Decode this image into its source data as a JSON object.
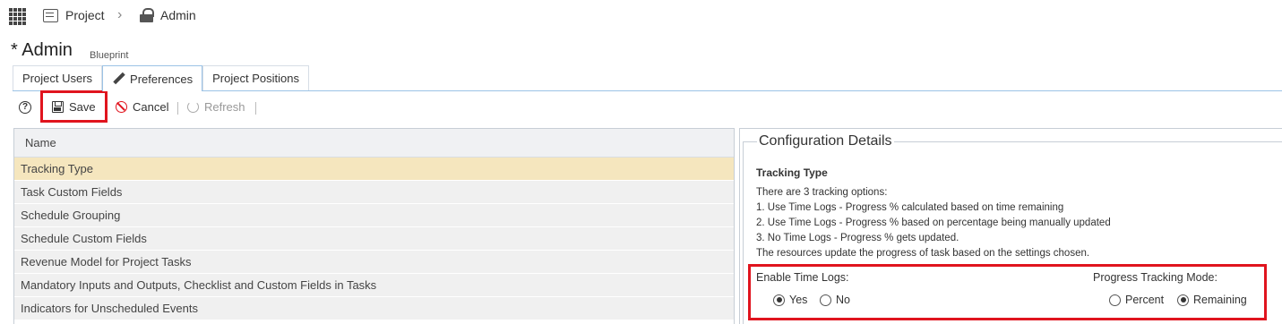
{
  "breadcrumb": {
    "project": "Project",
    "separator": "›",
    "admin": "Admin"
  },
  "title": {
    "main": "* Admin",
    "subtitle": "Blueprint"
  },
  "tabs": [
    {
      "label": "Project Users",
      "active": false
    },
    {
      "label": "Preferences",
      "active": true,
      "icon": "pencil-icon"
    },
    {
      "label": "Project Positions",
      "active": false
    }
  ],
  "toolbar": {
    "help": "?",
    "save": "Save",
    "cancel": "Cancel",
    "refresh": "Refresh"
  },
  "grid": {
    "header": "Name",
    "rows": [
      "Tracking Type",
      "Task Custom Fields",
      "Schedule Grouping",
      "Schedule Custom Fields",
      "Revenue Model for Project Tasks",
      "Mandatory Inputs and Outputs, Checklist and Custom Fields in Tasks",
      "Indicators for Unscheduled Events"
    ],
    "selected_index": 0
  },
  "config": {
    "legend": "Configuration Details",
    "heading": "Tracking Type",
    "lines": [
      "There are 3 tracking options:",
      "1. Use Time Logs - Progress % calculated based on time remaining",
      "2. Use Time Logs - Progress % based on percentage being manually updated",
      "3. No Time Logs - Progress % gets updated.",
      "The resources update the progress of task based on the settings chosen."
    ],
    "enable_time_logs": {
      "label": "Enable Time Logs:",
      "options": [
        "Yes",
        "No"
      ],
      "selected": "Yes"
    },
    "progress_mode": {
      "label": "Progress Tracking Mode:",
      "options": [
        "Percent",
        "Remaining"
      ],
      "selected": "Remaining"
    }
  },
  "colors": {
    "highlight": "#e0141e",
    "selected_row": "#f5e6be",
    "tab_border": "#9cc3e6"
  }
}
